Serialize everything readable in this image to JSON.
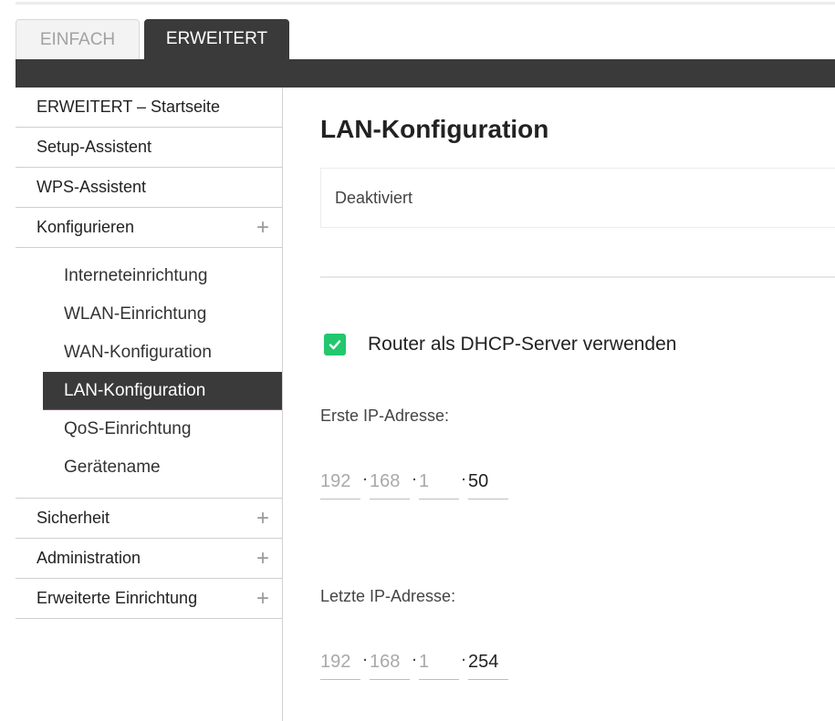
{
  "tabs": {
    "simple": "EINFACH",
    "advanced": "ERWEITERT"
  },
  "sidebar": {
    "items": [
      {
        "label": "ERWEITERT – Startseite"
      },
      {
        "label": "Setup-Assistent"
      },
      {
        "label": "WPS-Assistent"
      },
      {
        "label": "Konfigurieren"
      }
    ],
    "submenu": [
      {
        "label": "Interneteinrichtung"
      },
      {
        "label": "WLAN-Einrichtung"
      },
      {
        "label": "WAN-Konfiguration"
      },
      {
        "label": "LAN-Konfiguration"
      },
      {
        "label": "QoS-Einrichtung"
      },
      {
        "label": "Gerätename"
      }
    ],
    "bottom_items": [
      {
        "label": "Sicherheit"
      },
      {
        "label": "Administration"
      },
      {
        "label": "Erweiterte Einrichtung"
      }
    ],
    "expand_symbol": "+"
  },
  "main": {
    "title": "LAN-Konfiguration",
    "status": "Deaktiviert",
    "dhcp_label": "Router als DHCP-Server verwenden",
    "dhcp_checked": true,
    "first_ip": {
      "label": "Erste IP-Adresse:",
      "octets": [
        "192",
        "168",
        "1",
        "50"
      ]
    },
    "last_ip": {
      "label": "Letzte IP-Adresse:",
      "octets": [
        "192",
        "168",
        "1",
        "254"
      ]
    },
    "separator": "."
  },
  "colors": {
    "dark_bar": "#3a3a3a",
    "checkbox": "#22c76e",
    "active_underline": "#a33aa0"
  }
}
